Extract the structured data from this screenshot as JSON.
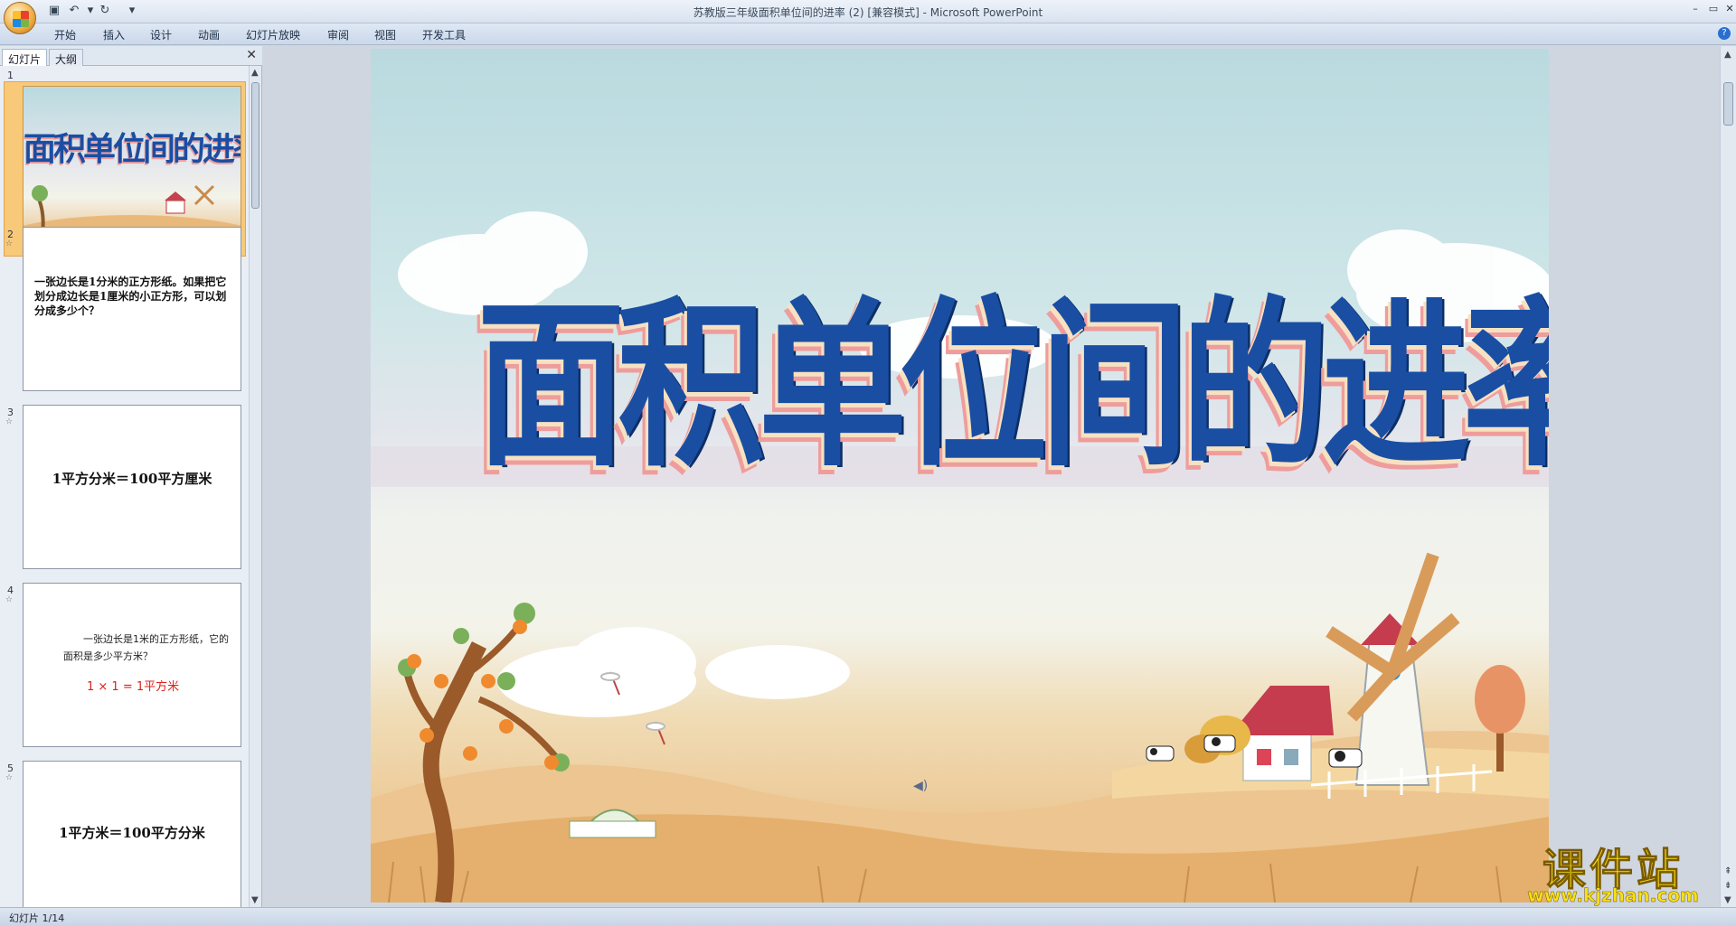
{
  "titlebar": {
    "document_title": "苏教版三年级面积单位间的进率 (2) [兼容模式] - Microsoft PowerPoint"
  },
  "ribbon": {
    "tabs": [
      "开始",
      "插入",
      "设计",
      "动画",
      "幻灯片放映",
      "审阅",
      "视图",
      "开发工具"
    ]
  },
  "left_pane": {
    "tab_slides": "幻灯片",
    "tab_outline": "大纲",
    "close_symbol": "✕",
    "slides": [
      {
        "number": "1",
        "title": "面积单位间的进率"
      },
      {
        "number": "2",
        "text": "一张边长是1分米的正方形纸。如果把它划分成边长是1厘米的小正方形，可以划分成多少个？"
      },
      {
        "number": "3",
        "text": "1平方分米＝100平方厘米"
      },
      {
        "number": "4",
        "text": "一张边长是1米的正方形纸，它的面积是多少平方米？",
        "answer": "1 × 1 = 1平方米"
      },
      {
        "number": "5",
        "text": "1平方米＝100平方分米"
      }
    ]
  },
  "slide": {
    "title": "面积单位间的进率"
  },
  "statusbar": {
    "text": "幻灯片 1/14"
  },
  "watermark": {
    "text": "课件站",
    "url": "www.kjzhan.com"
  },
  "colors": {
    "title_blue": "#1a4ea3",
    "answer_red": "#e0201a",
    "thumb_selected": "#f7c979",
    "watermark_yellow": "#f7e01a"
  }
}
